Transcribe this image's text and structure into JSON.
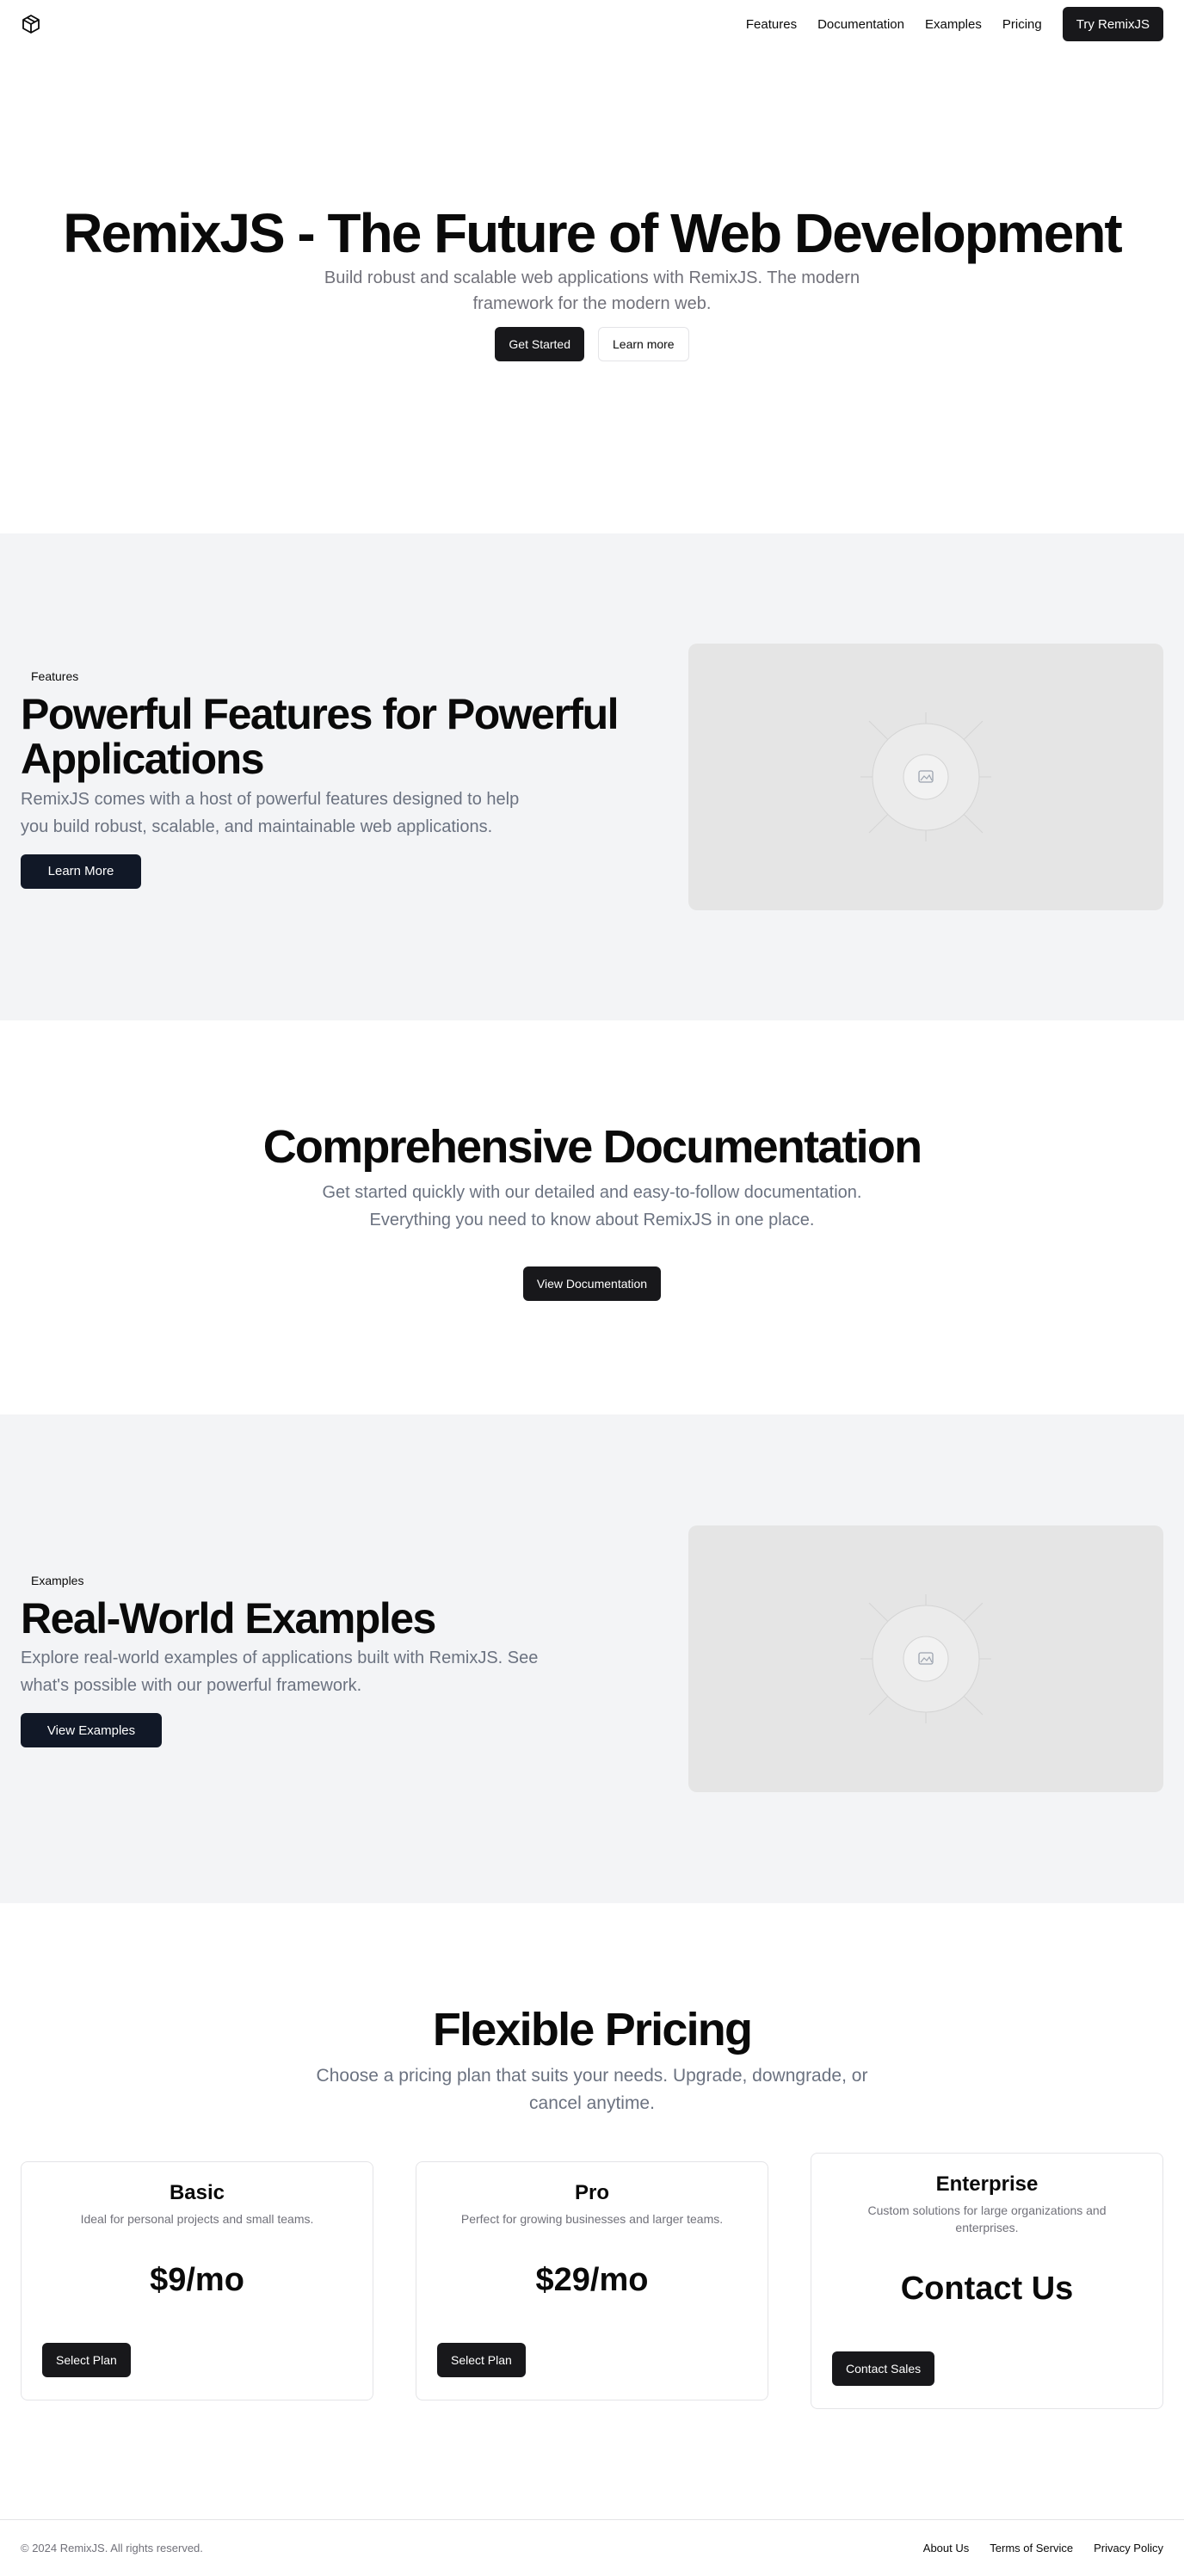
{
  "nav": {
    "links": [
      "Features",
      "Documentation",
      "Examples",
      "Pricing"
    ],
    "cta": "Try RemixJS"
  },
  "hero": {
    "title": "RemixJS - The Future of Web Development",
    "subtitle": "Build robust and scalable web applications with RemixJS. The modern framework for the modern web.",
    "primary_cta": "Get Started",
    "secondary_cta": "Learn more"
  },
  "features": {
    "badge": "Features",
    "title": "Powerful Features for Powerful Applications",
    "description": "RemixJS comes with a host of powerful features designed to help you build robust, scalable, and maintainable web applications.",
    "cta": "Learn More",
    "image_icon": "image-placeholder-icon"
  },
  "docs": {
    "title": "Comprehensive Documentation",
    "description": "Get started quickly with our detailed and easy-to-follow documentation. Everything you need to know about RemixJS in one place.",
    "cta": "View Documentation"
  },
  "examples": {
    "badge": "Examples",
    "title": "Real-World Examples",
    "description": "Explore real-world examples of applications built with RemixJS. See what's possible with our powerful framework.",
    "cta": "View Examples",
    "image_icon": "image-placeholder-icon"
  },
  "pricing": {
    "title": "Flexible Pricing",
    "subtitle": "Choose a pricing plan that suits your needs. Upgrade, downgrade, or cancel anytime.",
    "plans": [
      {
        "name": "Basic",
        "description": "Ideal for personal projects and small teams.",
        "price": "$9/mo",
        "cta": "Select Plan"
      },
      {
        "name": "Pro",
        "description": "Perfect for growing businesses and larger teams.",
        "price": "$29/mo",
        "cta": "Select Plan"
      },
      {
        "name": "Enterprise",
        "description": "Custom solutions for large organizations and enterprises.",
        "price": "Contact Us",
        "cta": "Contact Sales"
      }
    ]
  },
  "footer": {
    "copyright": "© 2024 RemixJS. All rights reserved.",
    "links": [
      "About Us",
      "Terms of Service",
      "Privacy Policy"
    ]
  },
  "colors": {
    "primary_button": "#18181b",
    "navy_button": "#111827",
    "section_background": "#f3f4f6",
    "muted_text": "#6b7280",
    "placeholder": "#e5e5e5"
  }
}
